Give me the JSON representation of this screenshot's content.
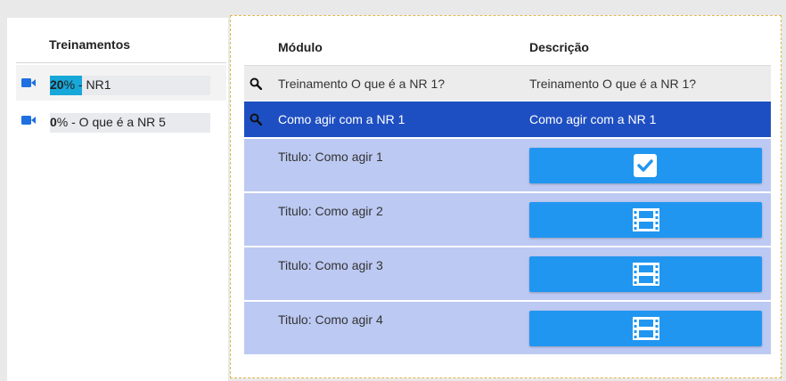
{
  "left": {
    "header": "Treinamentos",
    "items": [
      {
        "percent": "20",
        "suffix": "% - NR1",
        "progress": 20,
        "selected": true
      },
      {
        "percent": "0",
        "suffix": "% - O que é a NR 5",
        "progress": 0,
        "selected": false
      }
    ]
  },
  "right": {
    "col_module": "Módulo",
    "col_description": "Descrição",
    "rows": [
      {
        "module": "Treinamento O que é a NR 1?",
        "description": "Treinamento O que é a NR 1?"
      },
      {
        "module": "Como agir com a NR 1",
        "description": "Como agir com a NR 1"
      }
    ],
    "subitems": [
      {
        "title": "Titulo: Como agir 1",
        "action_icon": "checkbox-checked-icon"
      },
      {
        "title": "Titulo: Como agir 2",
        "action_icon": "film-icon"
      },
      {
        "title": "Titulo: Como agir 3",
        "action_icon": "film-icon"
      },
      {
        "title": "Titulo: Como agir 4",
        "action_icon": "film-icon"
      }
    ]
  },
  "colors": {
    "accent_blue": "#2196f0",
    "active_row": "#1e4fc2",
    "sub_bg": "#bcc9f2",
    "progress": "#17a7d8"
  }
}
